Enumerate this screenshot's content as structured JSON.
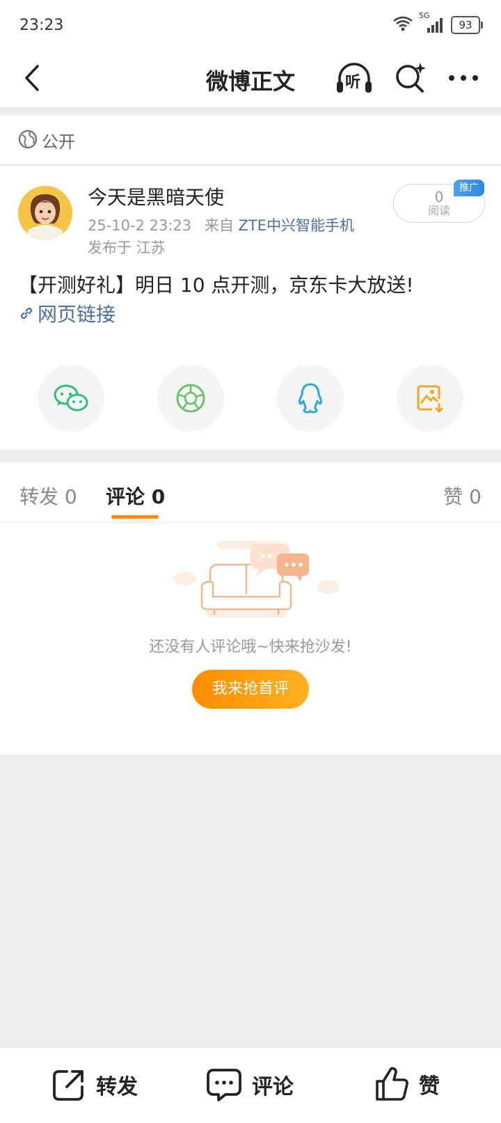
{
  "status_bar": {
    "time": "23:23",
    "network": "5G",
    "battery": "93"
  },
  "nav": {
    "title": "微博正文",
    "listen_label": "听"
  },
  "visibility": {
    "label": "公开"
  },
  "post": {
    "author": "今天是黑暗天使",
    "timestamp": "25-10-2 23:23",
    "source_prefix": "来自",
    "source_device": "ZTE中兴智能手机",
    "location": "发布于 江苏",
    "reads_count": "0",
    "reads_label": "阅读",
    "promo_badge": "推广",
    "content": "【开测好礼】明日 10 点开测，京东卡大放送!",
    "link_label": "网页链接"
  },
  "tabs": {
    "repost": {
      "label": "转发",
      "count": "0"
    },
    "comment": {
      "label": "评论",
      "count": "0"
    },
    "like": {
      "label": "赞",
      "count": "0"
    }
  },
  "empty_state": {
    "message": "还没有人评论哦~快来抢沙发!",
    "button_label": "我来抢首评"
  },
  "bottom_bar": {
    "repost_label": "转发",
    "comment_label": "评论",
    "like_label": "赞"
  },
  "colors": {
    "accent": "#ff8a00",
    "link": "#4e6e9e",
    "wechat": "#2fbe78",
    "moments": "#6ac36a",
    "qq": "#2aa6e0",
    "save": "#f5a623"
  }
}
